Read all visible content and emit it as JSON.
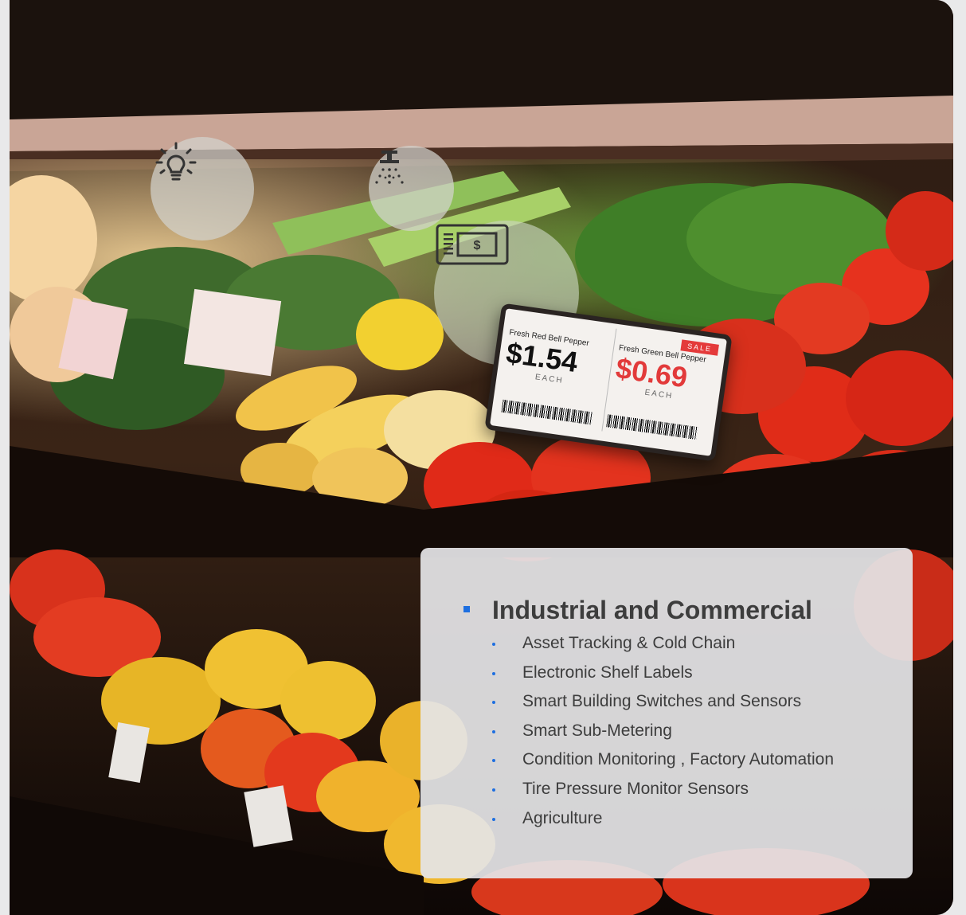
{
  "photo_caption": "",
  "icons": {
    "bulb": "lightbulb-icon",
    "sprinkler": "sprinkler-icon",
    "esl": "shelf-label-icon"
  },
  "shelf_label": {
    "left_product": "Fresh Red Bell Pepper",
    "left_price": "$1.54",
    "left_unit": "EACH",
    "right_product": "Fresh Green Bell Pepper",
    "right_price": "$0.69",
    "right_unit": "EACH",
    "sale_badge": "SALE"
  },
  "panel": {
    "heading": "Industrial and Commercial",
    "items": [
      "Asset Tracking & Cold Chain",
      "Electronic Shelf Labels",
      "Smart Building Switches and Sensors",
      "Smart Sub-Metering",
      "Condition Monitoring , Factory Automation",
      "Tire Pressure Monitor Sensors",
      "Agriculture"
    ]
  },
  "colors": {
    "accent": "#1e6fe0",
    "text": "#3d3d3d",
    "panel_bg": "#e4e4e6",
    "sale_red": "#e23a3a"
  }
}
